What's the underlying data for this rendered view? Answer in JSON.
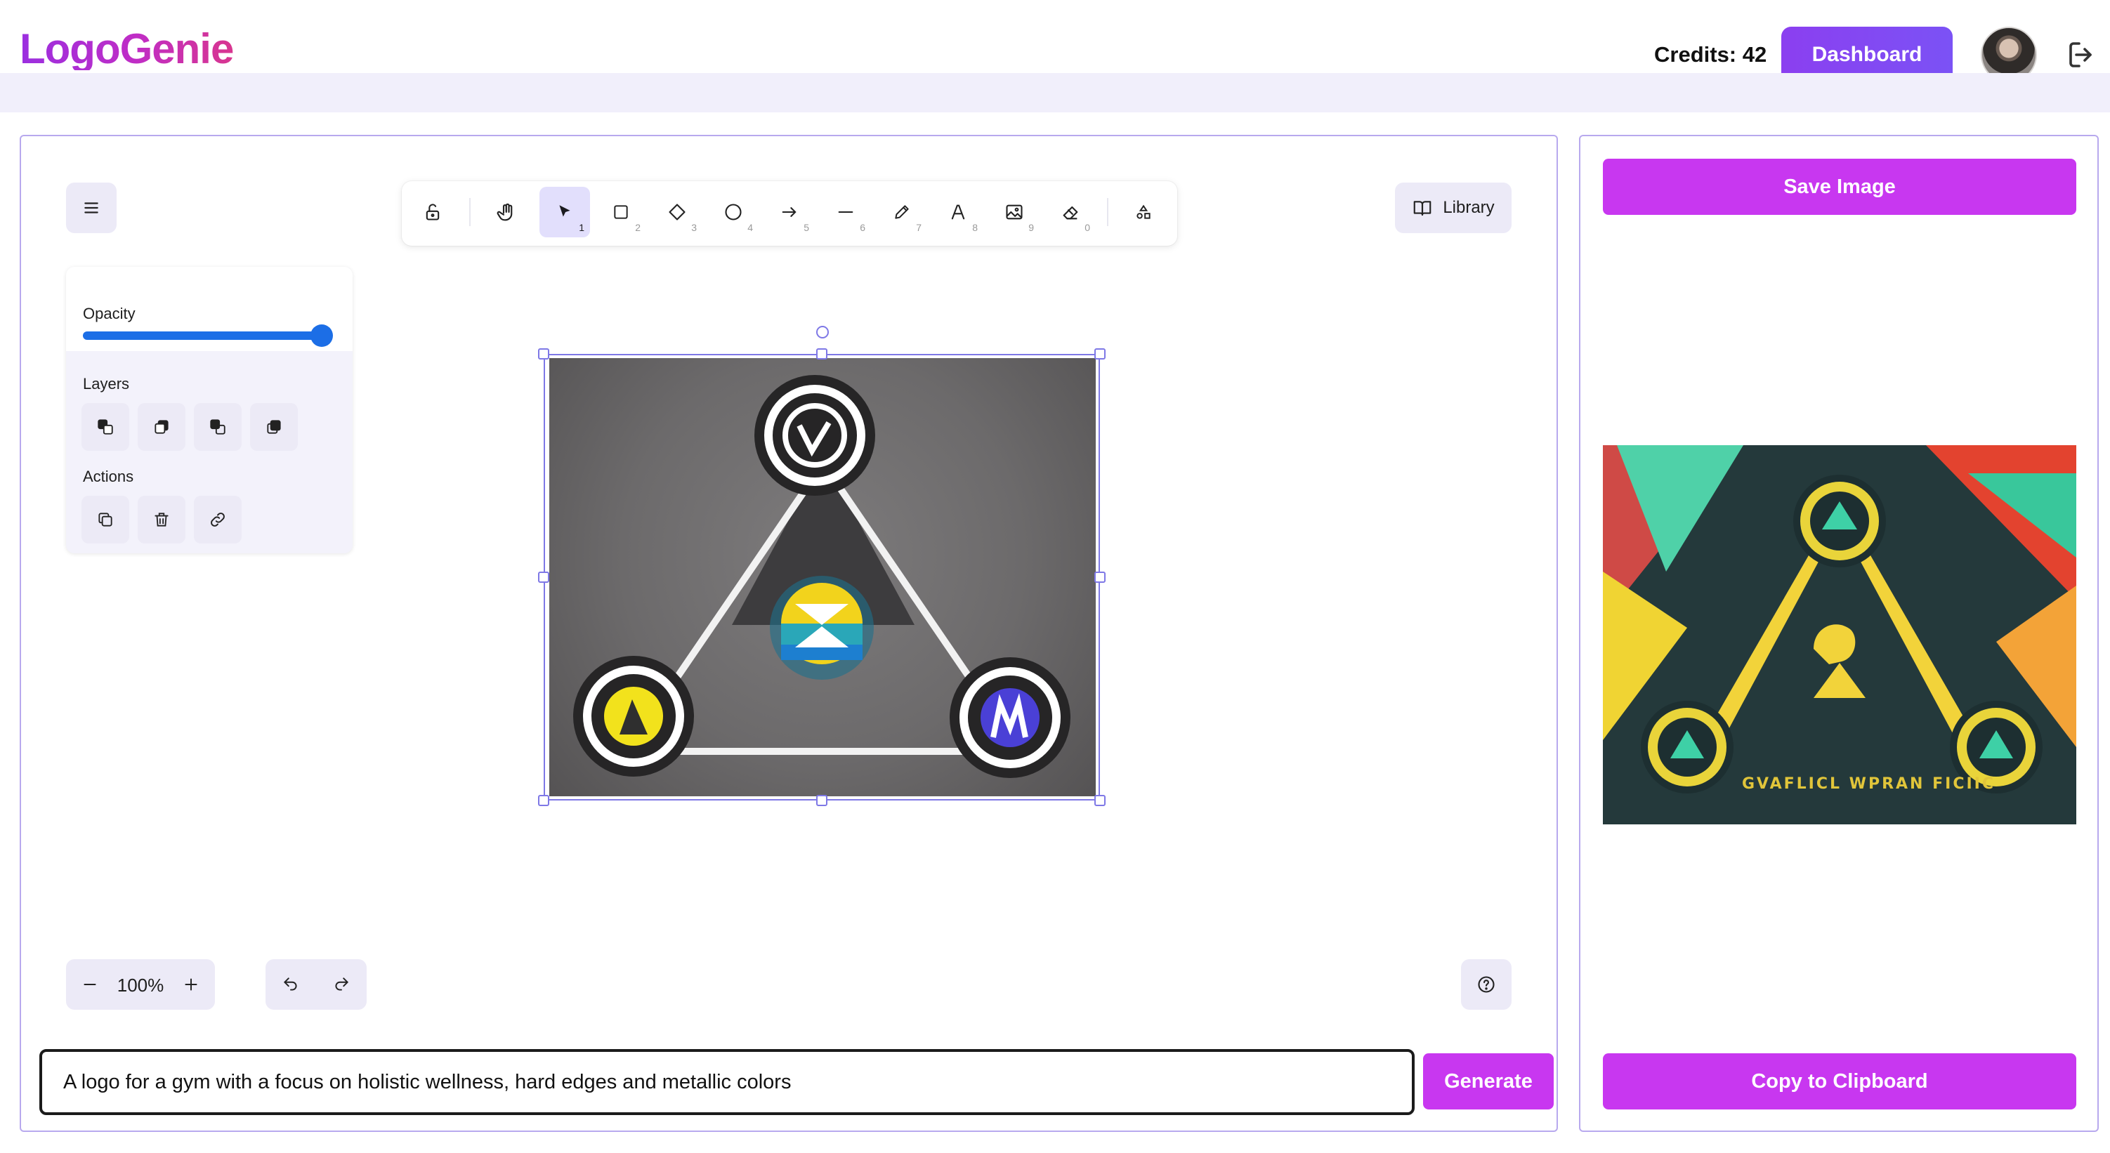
{
  "header": {
    "logo_text": "LogoGenie",
    "credits_label": "Credits: 42",
    "dashboard_label": "Dashboard",
    "avatar_icon": "user-avatar",
    "logout_icon": "logout-icon"
  },
  "toolbar": {
    "tools": [
      {
        "name": "lock",
        "icon": "lock-open-icon",
        "key": ""
      },
      {
        "name": "hand",
        "icon": "hand-icon",
        "key": ""
      },
      {
        "name": "selection",
        "icon": "pointer-icon",
        "key": "1",
        "active": true
      },
      {
        "name": "rectangle",
        "icon": "rectangle-icon",
        "key": "2"
      },
      {
        "name": "diamond",
        "icon": "diamond-icon",
        "key": "3"
      },
      {
        "name": "ellipse",
        "icon": "ellipse-icon",
        "key": "4"
      },
      {
        "name": "arrow",
        "icon": "arrow-icon",
        "key": "5"
      },
      {
        "name": "line",
        "icon": "line-icon",
        "key": "6"
      },
      {
        "name": "draw",
        "icon": "pencil-icon",
        "key": "7"
      },
      {
        "name": "text",
        "icon": "text-icon",
        "key": "8"
      },
      {
        "name": "image",
        "icon": "image-icon",
        "key": "9"
      },
      {
        "name": "eraser",
        "icon": "eraser-icon",
        "key": "0"
      },
      {
        "name": "extra-tools",
        "icon": "shapes-icon",
        "key": ""
      }
    ],
    "keys": {
      "k1": "1",
      "k2": "2",
      "k3": "3",
      "k4": "4",
      "k5": "5",
      "k6": "6",
      "k7": "7",
      "k8": "8",
      "k9": "9",
      "k0": "0"
    }
  },
  "library": {
    "label": "Library"
  },
  "properties": {
    "opacity_label": "Opacity",
    "opacity_value": 1.0,
    "layers_label": "Layers",
    "actions_label": "Actions"
  },
  "zoom": {
    "value": "100%"
  },
  "prompt": {
    "value": "A logo for a gym with a focus on holistic wellness, hard edges and metallic colors",
    "placeholder": ""
  },
  "generate_label": "Generate",
  "result": {
    "save_label": "Save Image",
    "copy_label": "Copy to Clipboard",
    "image_caption": "GVAFLICL WPRAN FICIIC"
  },
  "colors": {
    "brand_purple": "#c837f0",
    "dashboard_button": "#7b52f5",
    "panel_border": "#b8a9ee",
    "selection": "#7e78e6"
  }
}
